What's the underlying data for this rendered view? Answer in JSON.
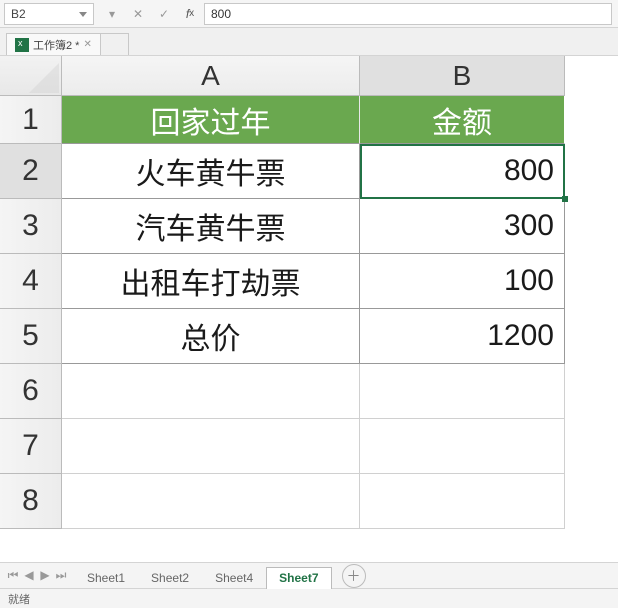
{
  "formula_bar": {
    "name_box": "B2",
    "formula": "800"
  },
  "doc_tab": {
    "title": "工作簿2 *"
  },
  "columns": [
    "A",
    "B"
  ],
  "row_numbers": [
    "1",
    "2",
    "3",
    "4",
    "5",
    "6",
    "7",
    "8"
  ],
  "table": {
    "header": {
      "A": "回家过年",
      "B": "金额"
    },
    "rows": [
      {
        "A": "火车黄牛票",
        "B": "800"
      },
      {
        "A": "汽车黄牛票",
        "B": "300"
      },
      {
        "A": "出租车打劫票",
        "B": "100"
      },
      {
        "A": "总价",
        "B": "1200"
      }
    ]
  },
  "active_cell": "B2",
  "sheet_tabs": [
    "Sheet1",
    "Sheet2",
    "Sheet4",
    "Sheet7"
  ],
  "active_sheet": "Sheet7",
  "status": "就绪",
  "chart_data": {
    "type": "table",
    "columns": [
      "回家过年",
      "金额"
    ],
    "rows": [
      [
        "火车黄牛票",
        800
      ],
      [
        "汽车黄牛票",
        300
      ],
      [
        "出租车打劫票",
        100
      ],
      [
        "总价",
        1200
      ]
    ]
  }
}
